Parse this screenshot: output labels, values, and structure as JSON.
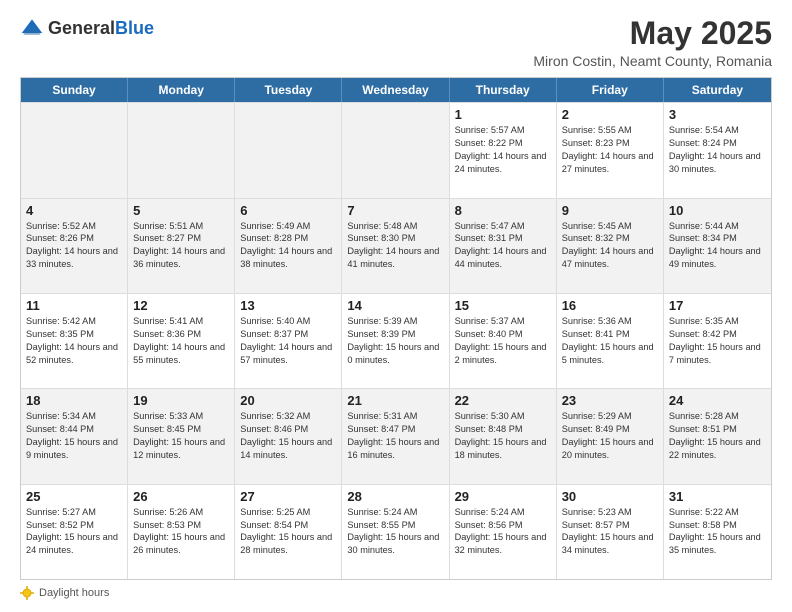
{
  "header": {
    "logo_general": "General",
    "logo_blue": "Blue",
    "title": "May 2025",
    "subtitle": "Miron Costin, Neamt County, Romania"
  },
  "calendar": {
    "days_of_week": [
      "Sunday",
      "Monday",
      "Tuesday",
      "Wednesday",
      "Thursday",
      "Friday",
      "Saturday"
    ],
    "weeks": [
      [
        {
          "day": "",
          "empty": true
        },
        {
          "day": "",
          "empty": true
        },
        {
          "day": "",
          "empty": true
        },
        {
          "day": "",
          "empty": true
        },
        {
          "day": "1",
          "sunrise": "Sunrise: 5:57 AM",
          "sunset": "Sunset: 8:22 PM",
          "daylight": "Daylight: 14 hours and 24 minutes."
        },
        {
          "day": "2",
          "sunrise": "Sunrise: 5:55 AM",
          "sunset": "Sunset: 8:23 PM",
          "daylight": "Daylight: 14 hours and 27 minutes."
        },
        {
          "day": "3",
          "sunrise": "Sunrise: 5:54 AM",
          "sunset": "Sunset: 8:24 PM",
          "daylight": "Daylight: 14 hours and 30 minutes."
        }
      ],
      [
        {
          "day": "4",
          "sunrise": "Sunrise: 5:52 AM",
          "sunset": "Sunset: 8:26 PM",
          "daylight": "Daylight: 14 hours and 33 minutes."
        },
        {
          "day": "5",
          "sunrise": "Sunrise: 5:51 AM",
          "sunset": "Sunset: 8:27 PM",
          "daylight": "Daylight: 14 hours and 36 minutes."
        },
        {
          "day": "6",
          "sunrise": "Sunrise: 5:49 AM",
          "sunset": "Sunset: 8:28 PM",
          "daylight": "Daylight: 14 hours and 38 minutes."
        },
        {
          "day": "7",
          "sunrise": "Sunrise: 5:48 AM",
          "sunset": "Sunset: 8:30 PM",
          "daylight": "Daylight: 14 hours and 41 minutes."
        },
        {
          "day": "8",
          "sunrise": "Sunrise: 5:47 AM",
          "sunset": "Sunset: 8:31 PM",
          "daylight": "Daylight: 14 hours and 44 minutes."
        },
        {
          "day": "9",
          "sunrise": "Sunrise: 5:45 AM",
          "sunset": "Sunset: 8:32 PM",
          "daylight": "Daylight: 14 hours and 47 minutes."
        },
        {
          "day": "10",
          "sunrise": "Sunrise: 5:44 AM",
          "sunset": "Sunset: 8:34 PM",
          "daylight": "Daylight: 14 hours and 49 minutes."
        }
      ],
      [
        {
          "day": "11",
          "sunrise": "Sunrise: 5:42 AM",
          "sunset": "Sunset: 8:35 PM",
          "daylight": "Daylight: 14 hours and 52 minutes."
        },
        {
          "day": "12",
          "sunrise": "Sunrise: 5:41 AM",
          "sunset": "Sunset: 8:36 PM",
          "daylight": "Daylight: 14 hours and 55 minutes."
        },
        {
          "day": "13",
          "sunrise": "Sunrise: 5:40 AM",
          "sunset": "Sunset: 8:37 PM",
          "daylight": "Daylight: 14 hours and 57 minutes."
        },
        {
          "day": "14",
          "sunrise": "Sunrise: 5:39 AM",
          "sunset": "Sunset: 8:39 PM",
          "daylight": "Daylight: 15 hours and 0 minutes."
        },
        {
          "day": "15",
          "sunrise": "Sunrise: 5:37 AM",
          "sunset": "Sunset: 8:40 PM",
          "daylight": "Daylight: 15 hours and 2 minutes."
        },
        {
          "day": "16",
          "sunrise": "Sunrise: 5:36 AM",
          "sunset": "Sunset: 8:41 PM",
          "daylight": "Daylight: 15 hours and 5 minutes."
        },
        {
          "day": "17",
          "sunrise": "Sunrise: 5:35 AM",
          "sunset": "Sunset: 8:42 PM",
          "daylight": "Daylight: 15 hours and 7 minutes."
        }
      ],
      [
        {
          "day": "18",
          "sunrise": "Sunrise: 5:34 AM",
          "sunset": "Sunset: 8:44 PM",
          "daylight": "Daylight: 15 hours and 9 minutes."
        },
        {
          "day": "19",
          "sunrise": "Sunrise: 5:33 AM",
          "sunset": "Sunset: 8:45 PM",
          "daylight": "Daylight: 15 hours and 12 minutes."
        },
        {
          "day": "20",
          "sunrise": "Sunrise: 5:32 AM",
          "sunset": "Sunset: 8:46 PM",
          "daylight": "Daylight: 15 hours and 14 minutes."
        },
        {
          "day": "21",
          "sunrise": "Sunrise: 5:31 AM",
          "sunset": "Sunset: 8:47 PM",
          "daylight": "Daylight: 15 hours and 16 minutes."
        },
        {
          "day": "22",
          "sunrise": "Sunrise: 5:30 AM",
          "sunset": "Sunset: 8:48 PM",
          "daylight": "Daylight: 15 hours and 18 minutes."
        },
        {
          "day": "23",
          "sunrise": "Sunrise: 5:29 AM",
          "sunset": "Sunset: 8:49 PM",
          "daylight": "Daylight: 15 hours and 20 minutes."
        },
        {
          "day": "24",
          "sunrise": "Sunrise: 5:28 AM",
          "sunset": "Sunset: 8:51 PM",
          "daylight": "Daylight: 15 hours and 22 minutes."
        }
      ],
      [
        {
          "day": "25",
          "sunrise": "Sunrise: 5:27 AM",
          "sunset": "Sunset: 8:52 PM",
          "daylight": "Daylight: 15 hours and 24 minutes."
        },
        {
          "day": "26",
          "sunrise": "Sunrise: 5:26 AM",
          "sunset": "Sunset: 8:53 PM",
          "daylight": "Daylight: 15 hours and 26 minutes."
        },
        {
          "day": "27",
          "sunrise": "Sunrise: 5:25 AM",
          "sunset": "Sunset: 8:54 PM",
          "daylight": "Daylight: 15 hours and 28 minutes."
        },
        {
          "day": "28",
          "sunrise": "Sunrise: 5:24 AM",
          "sunset": "Sunset: 8:55 PM",
          "daylight": "Daylight: 15 hours and 30 minutes."
        },
        {
          "day": "29",
          "sunrise": "Sunrise: 5:24 AM",
          "sunset": "Sunset: 8:56 PM",
          "daylight": "Daylight: 15 hours and 32 minutes."
        },
        {
          "day": "30",
          "sunrise": "Sunrise: 5:23 AM",
          "sunset": "Sunset: 8:57 PM",
          "daylight": "Daylight: 15 hours and 34 minutes."
        },
        {
          "day": "31",
          "sunrise": "Sunrise: 5:22 AM",
          "sunset": "Sunset: 8:58 PM",
          "daylight": "Daylight: 15 hours and 35 minutes."
        }
      ]
    ]
  },
  "footer": {
    "daylight_label": "Daylight hours"
  }
}
